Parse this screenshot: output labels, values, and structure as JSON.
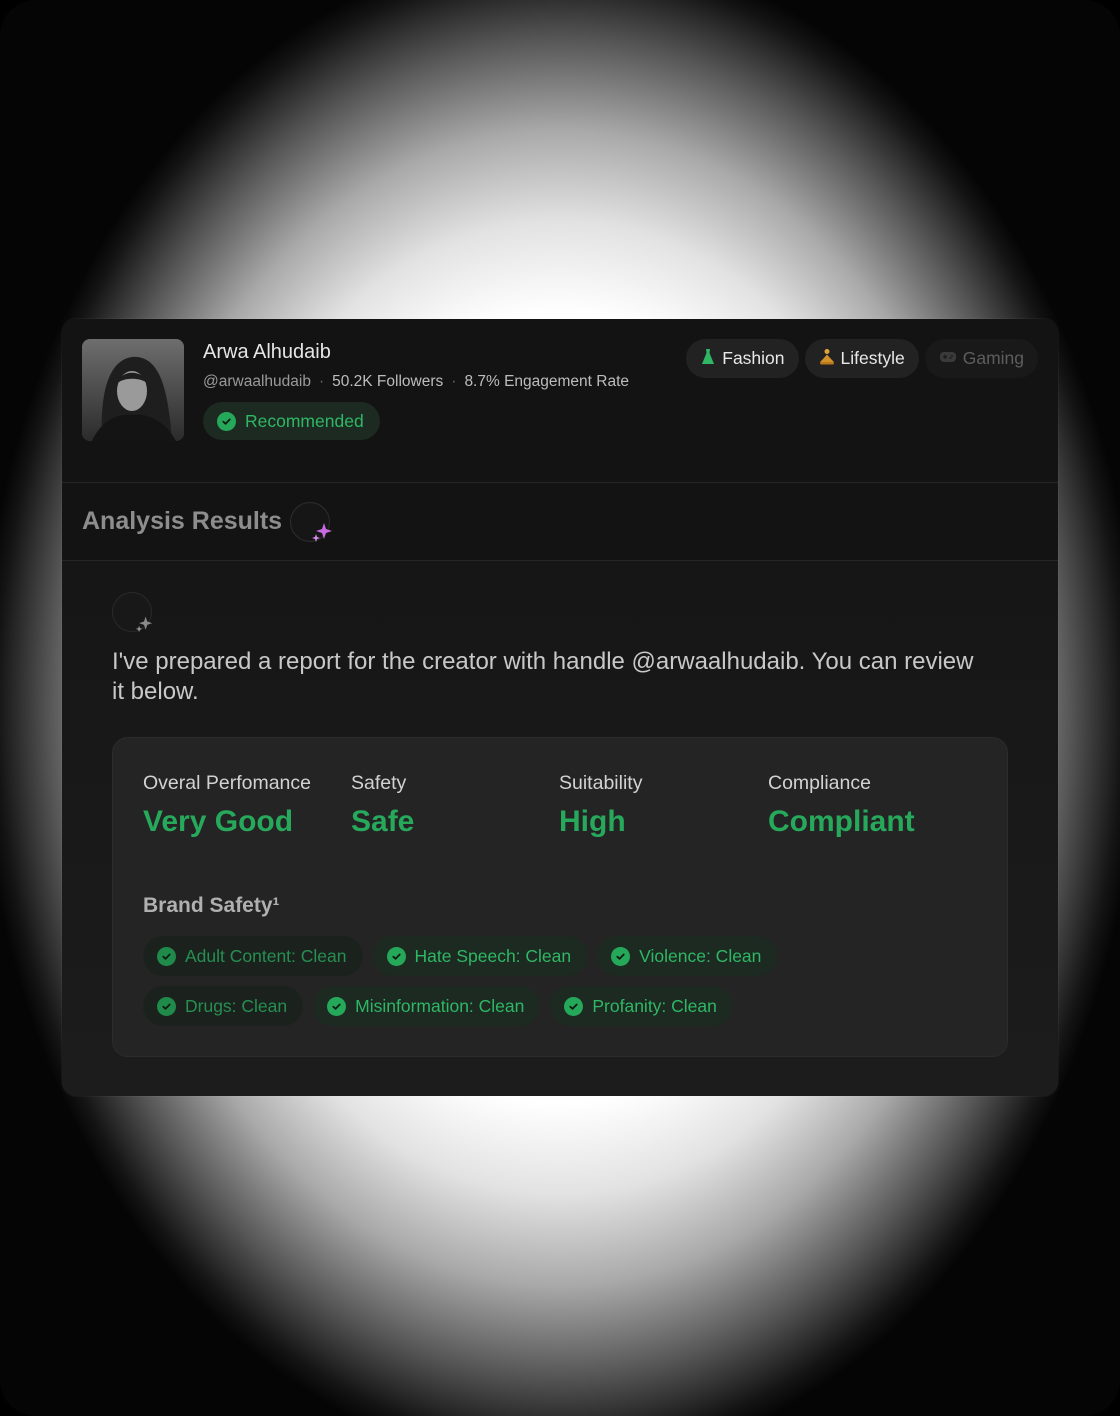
{
  "profile": {
    "name": "Arwa Alhudaib",
    "handle": "@arwaalhudaib",
    "followers": "50.2K Followers",
    "engagement": "8.7% Engagement Rate",
    "badge": "Recommended",
    "tags": [
      {
        "label": "Fashion",
        "icon": "dress-icon"
      },
      {
        "label": "Lifestyle",
        "icon": "meditation-icon"
      },
      {
        "label": "Gaming",
        "icon": "gamepad-icon"
      }
    ]
  },
  "analysis": {
    "title": "Analysis Results",
    "message": "I've prepared a report for the creator with handle @arwaalhudaib. You can review it below."
  },
  "report": {
    "metrics": [
      {
        "label": "Overal Perfomance",
        "value": "Very Good"
      },
      {
        "label": "Safety",
        "value": "Safe"
      },
      {
        "label": "Suitability",
        "value": "High"
      },
      {
        "label": "Compliance",
        "value": "Compliant"
      }
    ],
    "brand_safety_title": "Brand Safety¹",
    "brand_safety": [
      "Adult Content: Clean",
      "Hate Speech: Clean",
      "Violence: Clean",
      "Drugs: Clean",
      "Misinformation: Clean",
      "Profanity: Clean"
    ]
  },
  "colors": {
    "accent_green": "#27a95c",
    "sparkle_purple": "#c86be0"
  }
}
